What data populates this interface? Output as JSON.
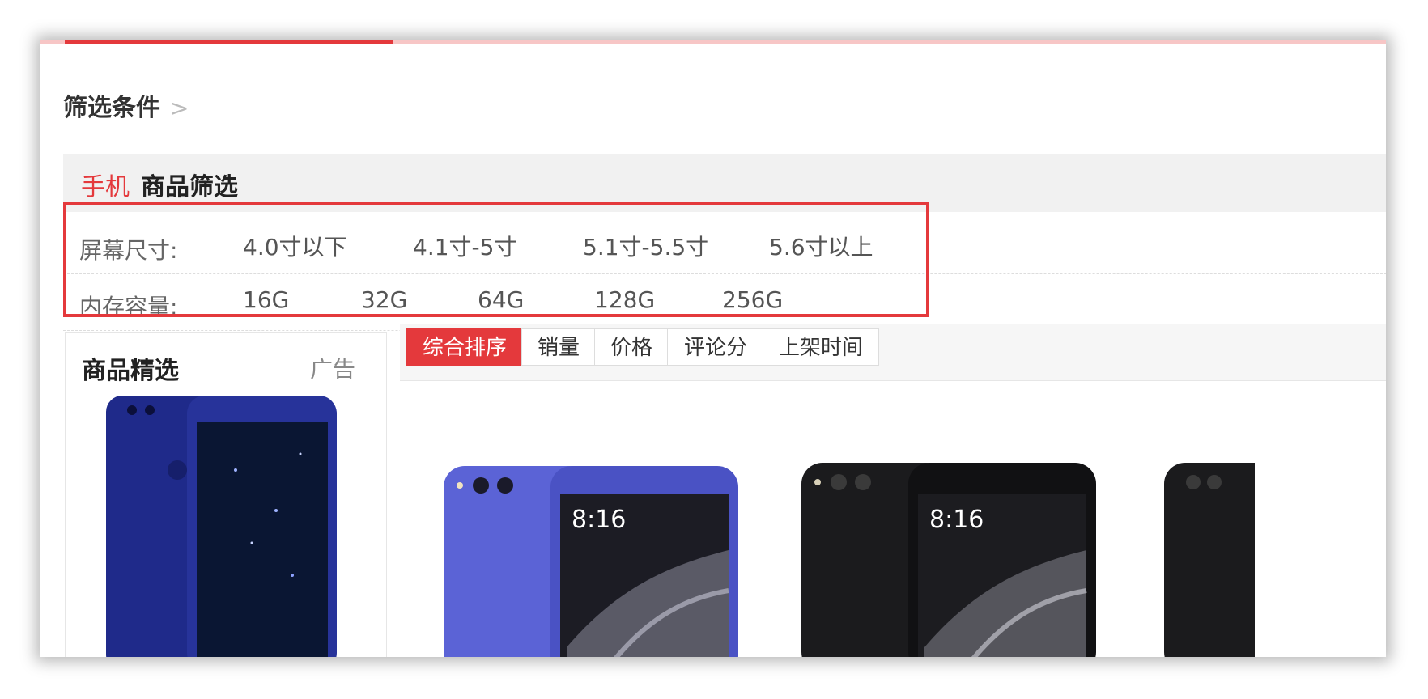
{
  "breadcrumb": {
    "label": "筛选条件",
    "chevron": ">"
  },
  "filter": {
    "category": "手机",
    "title": "商品筛选",
    "screen": {
      "label": "屏幕尺寸:",
      "options": [
        "4.0寸以下",
        "4.1寸-5寸",
        "5.1寸-5.5寸",
        "5.6寸以上"
      ]
    },
    "memory": {
      "label": "内存容量:",
      "options": [
        "16G",
        "32G",
        "64G",
        "128G",
        "256G"
      ]
    }
  },
  "sidebar": {
    "title": "商品精选",
    "ad": "广告"
  },
  "sort": {
    "tabs": [
      "综合排序",
      "销量",
      "价格",
      "评论分",
      "上架时间"
    ],
    "active_index": 0
  },
  "products": [
    {
      "screen_time": "8:16",
      "color": "blue"
    },
    {
      "screen_time": "8:16",
      "color": "black"
    }
  ],
  "colors": {
    "accent": "#e4393c"
  }
}
